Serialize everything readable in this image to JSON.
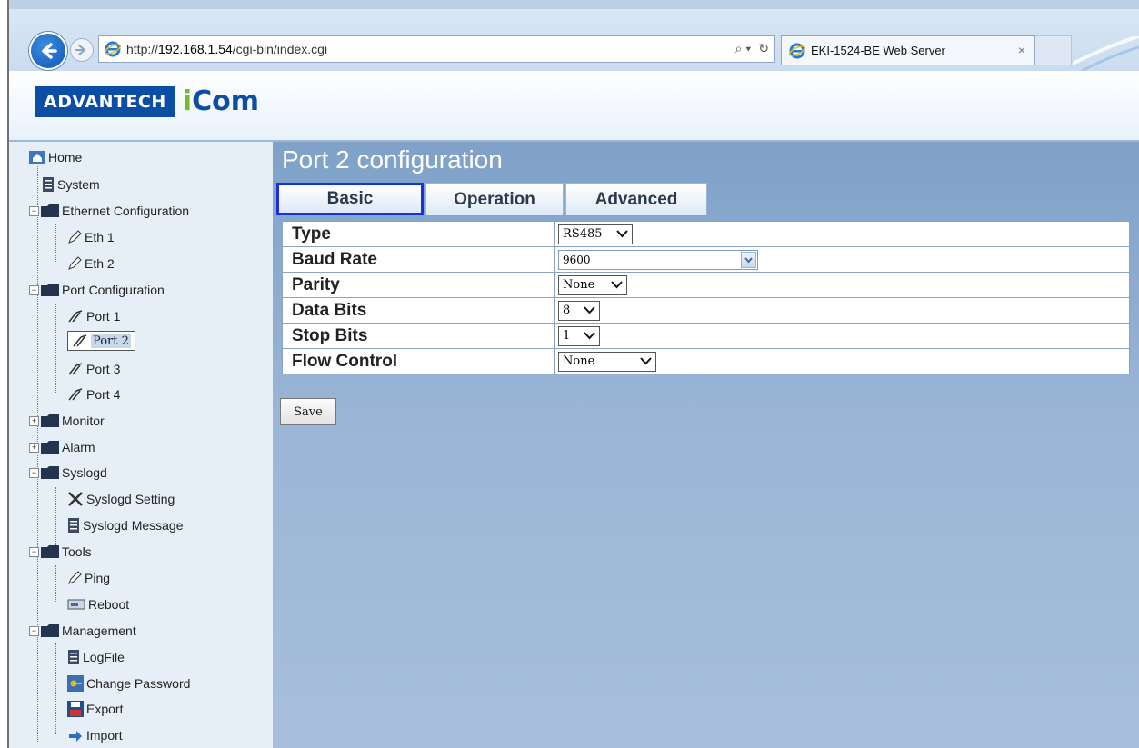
{
  "browser": {
    "url_prefix": "http://",
    "url_host": "192.168.1.54",
    "url_path": "/cgi-bin/index.cgi",
    "tab_title": "EKI-1524-BE Web Server",
    "tab_close": "×",
    "search_glyph": "⌕ ▾",
    "refresh_glyph": "↻"
  },
  "logo": {
    "brand": "ADVANTECH",
    "product_i": "i",
    "product_rest": "Com"
  },
  "sidebar": {
    "items": [
      {
        "label": "Home"
      },
      {
        "label": "System"
      },
      {
        "label": "Ethernet Configuration"
      },
      {
        "label": "Eth 1"
      },
      {
        "label": "Eth 2"
      },
      {
        "label": "Port Configuration"
      },
      {
        "label": "Port 1"
      },
      {
        "label": "Port 2"
      },
      {
        "label": "Port 3"
      },
      {
        "label": "Port 4"
      },
      {
        "label": "Monitor"
      },
      {
        "label": "Alarm"
      },
      {
        "label": "Syslogd"
      },
      {
        "label": "Syslogd Setting"
      },
      {
        "label": "Syslogd Message"
      },
      {
        "label": "Tools"
      },
      {
        "label": "Ping"
      },
      {
        "label": "Reboot"
      },
      {
        "label": "Management"
      },
      {
        "label": "LogFile"
      },
      {
        "label": "Change Password"
      },
      {
        "label": "Export"
      },
      {
        "label": "Import"
      }
    ]
  },
  "main": {
    "title": "Port 2 configuration",
    "tabs": [
      {
        "label": "Basic",
        "active": true
      },
      {
        "label": "Operation"
      },
      {
        "label": "Advanced"
      }
    ],
    "fields": [
      {
        "label": "Type",
        "value": "RS485"
      },
      {
        "label": "Baud Rate",
        "value": "9600"
      },
      {
        "label": "Parity",
        "value": "None"
      },
      {
        "label": "Data Bits",
        "value": "8"
      },
      {
        "label": "Stop Bits",
        "value": "1"
      },
      {
        "label": "Flow Control",
        "value": "None"
      }
    ],
    "save_label": "Save"
  },
  "colors": {
    "brand_blue": "#0c4ea3",
    "icom_green": "#7ab929",
    "active_tab_border": "#1a2fe0",
    "content_bg": "#9ab5d6"
  }
}
